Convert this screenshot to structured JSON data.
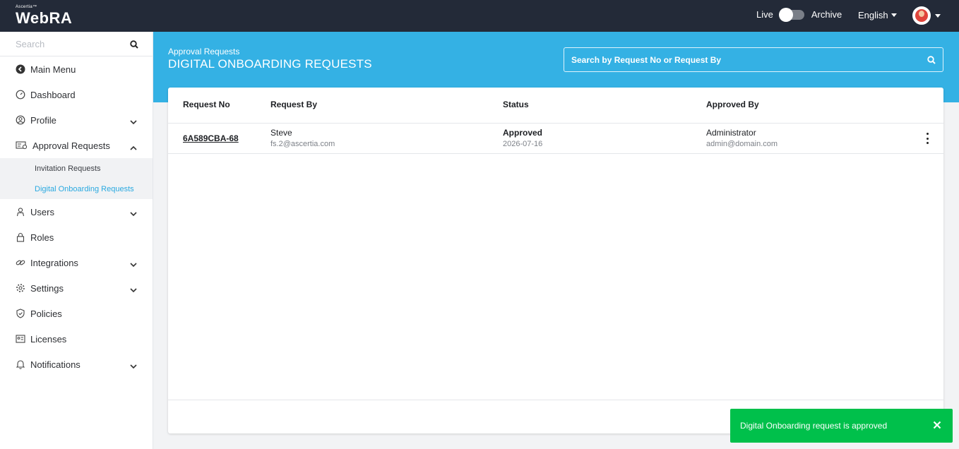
{
  "header": {
    "logo_small": "Ascertia™",
    "logo_big": "WebRA",
    "live_label": "Live",
    "archive_label": "Archive",
    "language": "English"
  },
  "sidebar": {
    "search_placeholder": "Search",
    "items": [
      {
        "label": "Main Menu",
        "icon": "back-circle-icon"
      },
      {
        "label": "Dashboard",
        "icon": "dashboard-icon"
      },
      {
        "label": "Profile",
        "icon": "user-circle-icon"
      },
      {
        "label": "Approval Requests",
        "icon": "approval-icon"
      },
      {
        "label": "Users",
        "icon": "users-icon"
      },
      {
        "label": "Roles",
        "icon": "lock-icon"
      },
      {
        "label": "Integrations",
        "icon": "link-icon"
      },
      {
        "label": "Settings",
        "icon": "gear-icon"
      },
      {
        "label": "Policies",
        "icon": "shield-icon"
      },
      {
        "label": "Licenses",
        "icon": "license-icon"
      },
      {
        "label": "Notifications",
        "icon": "bell-icon"
      }
    ],
    "subitems": [
      {
        "label": "Invitation Requests"
      },
      {
        "label": "Digital Onboarding Requests"
      }
    ]
  },
  "page": {
    "breadcrumb": "Approval Requests",
    "title": "DIGITAL ONBOARDING REQUESTS",
    "search_placeholder": "Search by Request No or Request By"
  },
  "table": {
    "headers": [
      "Request No",
      "Request By",
      "Status",
      "Approved By"
    ],
    "rows": [
      {
        "request_no": "6A589CBA-68",
        "request_by": "Steve",
        "request_by_email": "fs.2@ascertia.com",
        "status": "Approved",
        "date": "2026-07-16",
        "approved_by": "Administrator",
        "approved_by_email": "admin@domain.com"
      }
    ]
  },
  "toast": {
    "message": "Digital Onboarding request is approved"
  },
  "colors": {
    "topbar": "#232a38",
    "accent": "#34b1e4",
    "toast": "#00c04b",
    "active_link": "#2aa9e0"
  }
}
